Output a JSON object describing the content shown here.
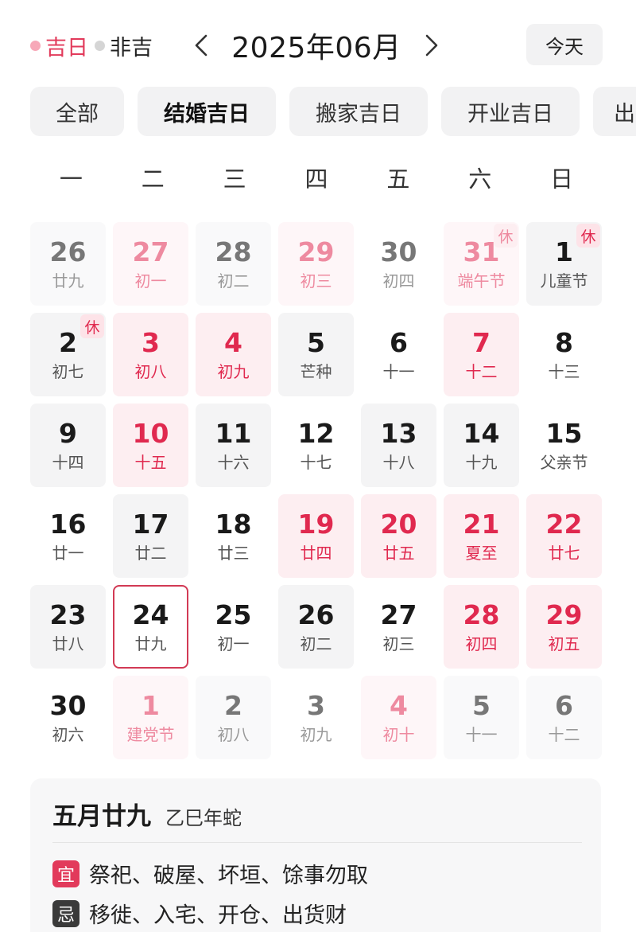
{
  "legend": {
    "auspicious": "吉日",
    "inauspicious": "非吉"
  },
  "nav": {
    "month": "2025年06月",
    "today": "今天"
  },
  "tabs": [
    "全部",
    "结婚吉日",
    "搬家吉日",
    "开业吉日",
    "出"
  ],
  "weekdays": [
    "一",
    "二",
    "三",
    "四",
    "五",
    "六",
    "日"
  ],
  "calendar": [
    {
      "day": "26",
      "lunar": "廿九",
      "bg": "grey",
      "tone": "black",
      "other": true
    },
    {
      "day": "27",
      "lunar": "初一",
      "bg": "pink",
      "tone": "red",
      "other": true
    },
    {
      "day": "28",
      "lunar": "初二",
      "bg": "grey",
      "tone": "black",
      "other": true
    },
    {
      "day": "29",
      "lunar": "初三",
      "bg": "pink",
      "tone": "red",
      "other": true
    },
    {
      "day": "30",
      "lunar": "初四",
      "bg": "none",
      "tone": "black",
      "other": true
    },
    {
      "day": "31",
      "lunar": "端午节",
      "bg": "pink",
      "tone": "red",
      "other": true,
      "holiday": "休"
    },
    {
      "day": "1",
      "lunar": "儿童节",
      "bg": "grey",
      "tone": "black",
      "holiday": "休"
    },
    {
      "day": "2",
      "lunar": "初七",
      "bg": "grey",
      "tone": "black",
      "holiday": "休"
    },
    {
      "day": "3",
      "lunar": "初八",
      "bg": "pink",
      "tone": "red"
    },
    {
      "day": "4",
      "lunar": "初九",
      "bg": "pink",
      "tone": "red"
    },
    {
      "day": "5",
      "lunar": "芒种",
      "bg": "grey",
      "tone": "black"
    },
    {
      "day": "6",
      "lunar": "十一",
      "bg": "none",
      "tone": "black"
    },
    {
      "day": "7",
      "lunar": "十二",
      "bg": "pink",
      "tone": "red"
    },
    {
      "day": "8",
      "lunar": "十三",
      "bg": "none",
      "tone": "black"
    },
    {
      "day": "9",
      "lunar": "十四",
      "bg": "grey",
      "tone": "black"
    },
    {
      "day": "10",
      "lunar": "十五",
      "bg": "pink",
      "tone": "red"
    },
    {
      "day": "11",
      "lunar": "十六",
      "bg": "grey",
      "tone": "black"
    },
    {
      "day": "12",
      "lunar": "十七",
      "bg": "none",
      "tone": "black"
    },
    {
      "day": "13",
      "lunar": "十八",
      "bg": "grey",
      "tone": "black"
    },
    {
      "day": "14",
      "lunar": "十九",
      "bg": "grey",
      "tone": "black"
    },
    {
      "day": "15",
      "lunar": "父亲节",
      "bg": "none",
      "tone": "black"
    },
    {
      "day": "16",
      "lunar": "廿一",
      "bg": "none",
      "tone": "black"
    },
    {
      "day": "17",
      "lunar": "廿二",
      "bg": "grey",
      "tone": "black"
    },
    {
      "day": "18",
      "lunar": "廿三",
      "bg": "none",
      "tone": "black"
    },
    {
      "day": "19",
      "lunar": "廿四",
      "bg": "pink",
      "tone": "red"
    },
    {
      "day": "20",
      "lunar": "廿五",
      "bg": "pink",
      "tone": "red"
    },
    {
      "day": "21",
      "lunar": "夏至",
      "bg": "pink",
      "tone": "red"
    },
    {
      "day": "22",
      "lunar": "廿七",
      "bg": "pink",
      "tone": "red"
    },
    {
      "day": "23",
      "lunar": "廿八",
      "bg": "grey",
      "tone": "black"
    },
    {
      "day": "24",
      "lunar": "廿九",
      "bg": "none",
      "tone": "black",
      "selected": true
    },
    {
      "day": "25",
      "lunar": "初一",
      "bg": "none",
      "tone": "black"
    },
    {
      "day": "26",
      "lunar": "初二",
      "bg": "grey",
      "tone": "black"
    },
    {
      "day": "27",
      "lunar": "初三",
      "bg": "none",
      "tone": "black"
    },
    {
      "day": "28",
      "lunar": "初四",
      "bg": "pink",
      "tone": "red"
    },
    {
      "day": "29",
      "lunar": "初五",
      "bg": "pink",
      "tone": "red"
    },
    {
      "day": "30",
      "lunar": "初六",
      "bg": "none",
      "tone": "black"
    },
    {
      "day": "1",
      "lunar": "建党节",
      "bg": "pink",
      "tone": "red",
      "other": true
    },
    {
      "day": "2",
      "lunar": "初八",
      "bg": "grey",
      "tone": "black",
      "other": true
    },
    {
      "day": "3",
      "lunar": "初九",
      "bg": "none",
      "tone": "black",
      "other": true
    },
    {
      "day": "4",
      "lunar": "初十",
      "bg": "pink",
      "tone": "red",
      "other": true
    },
    {
      "day": "5",
      "lunar": "十一",
      "bg": "grey",
      "tone": "black",
      "other": true
    },
    {
      "day": "6",
      "lunar": "十二",
      "bg": "grey",
      "tone": "black",
      "other": true
    }
  ],
  "detail": {
    "lunar_date": "五月廿九",
    "ganzhi": "乙巳年蛇",
    "yi_label": "宜",
    "yi_text": "祭祀、破屋、坏垣、馀事勿取",
    "ji_label": "忌",
    "ji_text": "移徙、入宅、开仓、出货财"
  },
  "colors": {
    "accent_red": "#e0294f",
    "pink_bg": "#fdeef1",
    "grey_bg": "#f4f4f5"
  }
}
